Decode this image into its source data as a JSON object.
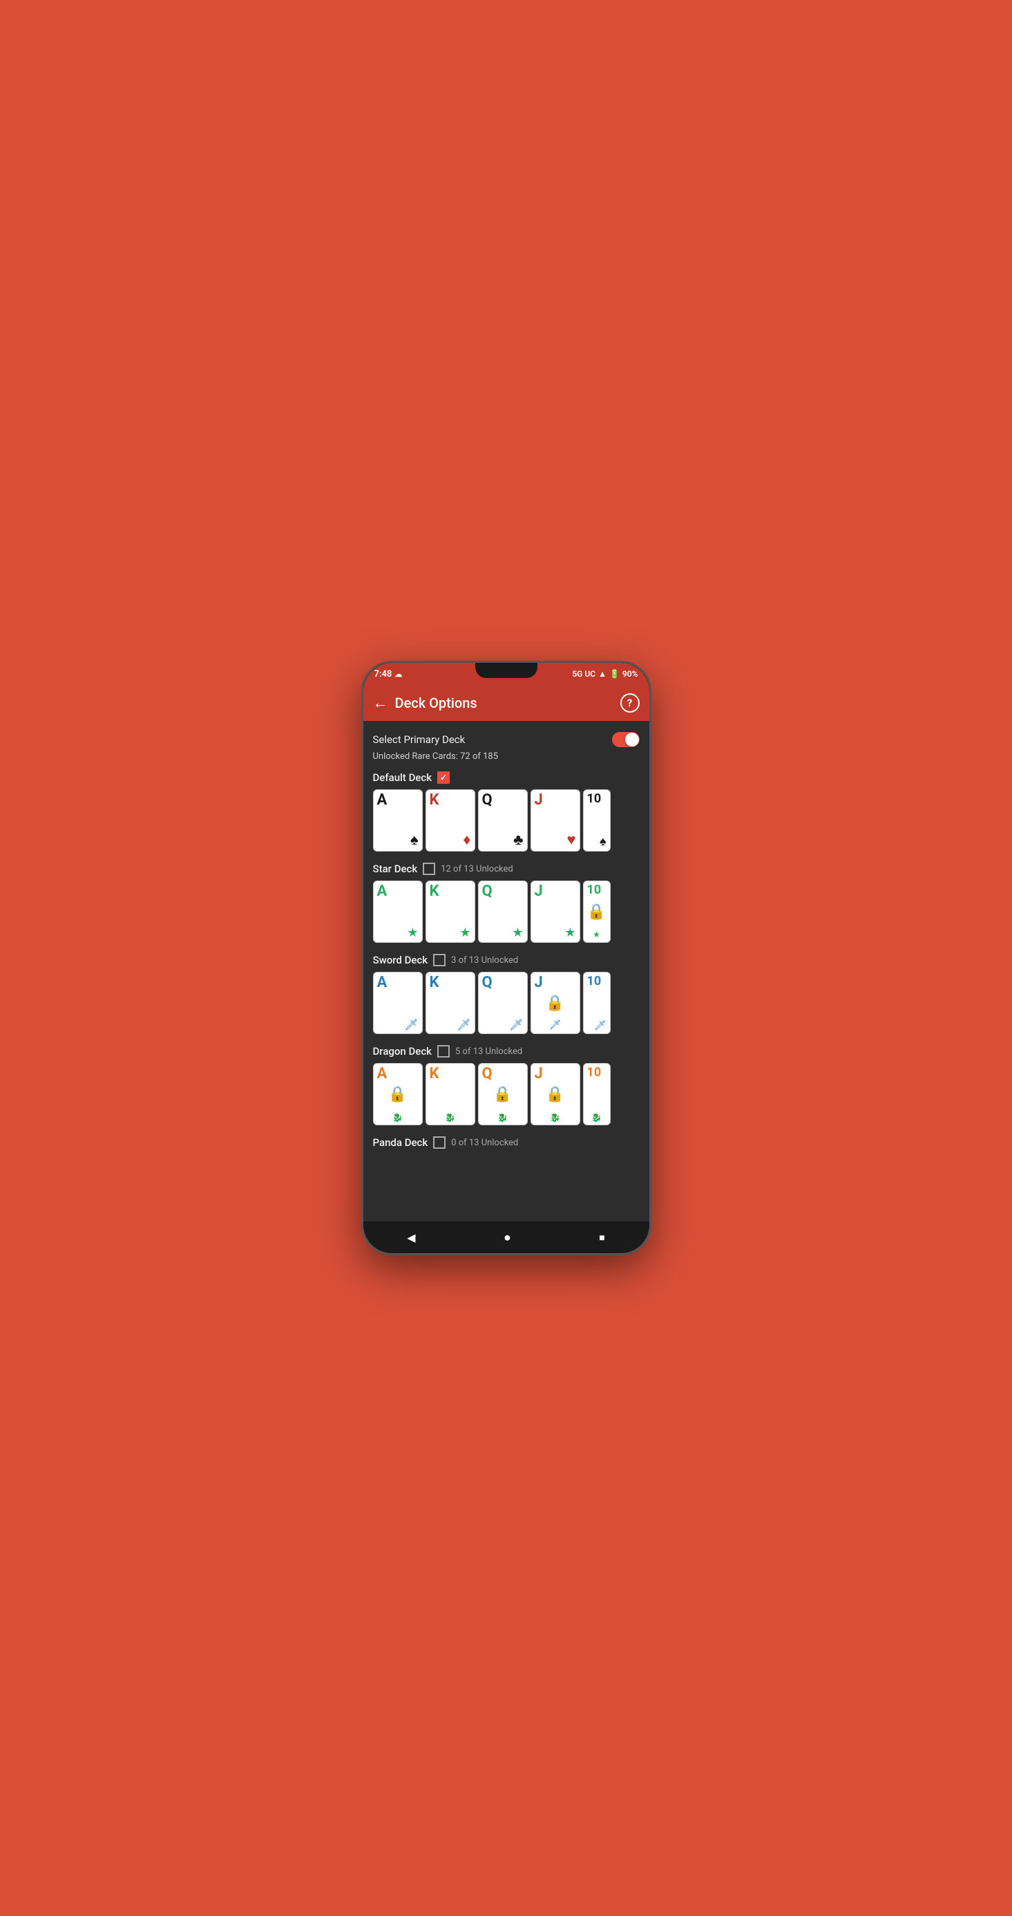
{
  "status_bar": {
    "time": "7:48",
    "network": "5G UC",
    "battery": "90%"
  },
  "app_bar": {
    "title": "Deck Options",
    "back_label": "←",
    "help_label": "?"
  },
  "primary_deck": {
    "label": "Select Primary Deck",
    "toggle_on": true
  },
  "unlocked_rare": {
    "text": "Unlocked Rare Cards: 72 of 185"
  },
  "decks": [
    {
      "name": "Default Deck",
      "checked": true,
      "unlock_text": "",
      "cards": [
        {
          "value": "A",
          "suit": "♠",
          "suit_color": "black",
          "value_color": "black",
          "symbol": "♠",
          "symbol_color": "black",
          "locked": false
        },
        {
          "value": "K",
          "suit": "♦",
          "suit_color": "red",
          "value_color": "red",
          "symbol": "♦",
          "symbol_color": "red",
          "locked": false
        },
        {
          "value": "Q",
          "suit": "♣",
          "suit_color": "black",
          "value_color": "black",
          "symbol": "♣",
          "symbol_color": "black",
          "locked": false
        },
        {
          "value": "J",
          "suit": "♥",
          "suit_color": "red",
          "value_color": "red",
          "symbol": "♥",
          "symbol_color": "red",
          "locked": false
        },
        {
          "value": "10",
          "suit": "♠",
          "suit_color": "black",
          "value_color": "black",
          "symbol": "♠",
          "symbol_color": "black",
          "locked": false,
          "partial": true
        }
      ]
    },
    {
      "name": "Star Deck",
      "checked": false,
      "unlock_text": "12 of 13 Unlocked",
      "deck_color": "green",
      "cards": [
        {
          "value": "A",
          "suit": "★",
          "suit_color": "green",
          "value_color": "green",
          "symbol": "★",
          "symbol_color": "green",
          "locked": false
        },
        {
          "value": "K",
          "suit": "★",
          "suit_color": "green",
          "value_color": "green",
          "symbol": "★",
          "symbol_color": "green",
          "locked": false
        },
        {
          "value": "Q",
          "suit": "★",
          "suit_color": "green",
          "value_color": "green",
          "symbol": "★",
          "symbol_color": "green",
          "locked": false
        },
        {
          "value": "J",
          "suit": "★",
          "suit_color": "green",
          "value_color": "green",
          "symbol": "★",
          "symbol_color": "green",
          "locked": false
        },
        {
          "value": "10",
          "suit": "★",
          "suit_color": "green",
          "value_color": "green",
          "symbol": "★",
          "symbol_color": "green",
          "locked": true,
          "partial": true
        }
      ]
    },
    {
      "name": "Sword Deck",
      "checked": false,
      "unlock_text": "3 of 13 Unlocked",
      "deck_color": "blue",
      "cards": [
        {
          "value": "A",
          "suit": "⚔",
          "suit_color": "blue",
          "value_color": "blue",
          "symbol": "⚔",
          "symbol_color": "blue",
          "locked": false
        },
        {
          "value": "K",
          "suit": "⚔",
          "suit_color": "blue",
          "value_color": "blue",
          "symbol": "⚔",
          "symbol_color": "blue",
          "locked": false
        },
        {
          "value": "Q",
          "suit": "⚔",
          "suit_color": "blue",
          "value_color": "blue",
          "symbol": "⚔",
          "symbol_color": "blue",
          "locked": false
        },
        {
          "value": "J",
          "suit": "⚔",
          "suit_color": "blue",
          "value_color": "blue",
          "symbol": "⚔",
          "symbol_color": "blue",
          "locked": true
        },
        {
          "value": "10",
          "suit": "⚔",
          "suit_color": "blue",
          "value_color": "blue",
          "symbol": "⚔",
          "symbol_color": "blue",
          "locked": false,
          "partial": true
        }
      ]
    },
    {
      "name": "Dragon Deck",
      "checked": false,
      "unlock_text": "5 of 13 Unlocked",
      "deck_color": "orange",
      "cards": [
        {
          "value": "A",
          "suit": "🐉",
          "suit_color": "orange",
          "value_color": "orange",
          "symbol": "🐉",
          "symbol_color": "orange",
          "locked": true
        },
        {
          "value": "K",
          "suit": "🐉",
          "suit_color": "orange",
          "value_color": "orange",
          "symbol": "🐉",
          "symbol_color": "orange",
          "locked": false
        },
        {
          "value": "Q",
          "suit": "🐉",
          "suit_color": "orange",
          "value_color": "orange",
          "symbol": "🐉",
          "symbol_color": "orange",
          "locked": true
        },
        {
          "value": "J",
          "suit": "🐉",
          "suit_color": "orange",
          "value_color": "orange",
          "symbol": "🐉",
          "symbol_color": "orange",
          "locked": true
        },
        {
          "value": "10",
          "suit": "🐉",
          "suit_color": "orange",
          "value_color": "orange",
          "symbol": "🐉",
          "symbol_color": "orange",
          "locked": false,
          "partial": true
        }
      ]
    },
    {
      "name": "Panda Deck",
      "checked": false,
      "unlock_text": "0 of 13 Unlocked",
      "deck_color": "black",
      "cards": []
    }
  ],
  "nav": {
    "back": "◀",
    "home": "●",
    "recents": "■"
  }
}
